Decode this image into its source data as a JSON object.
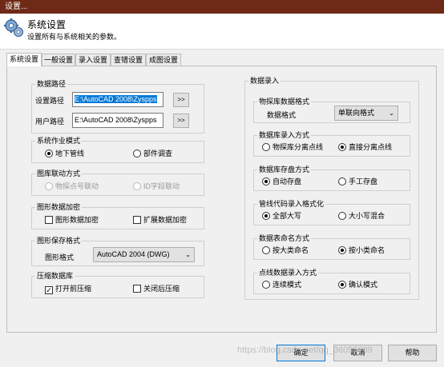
{
  "window_title": "设置...",
  "header": {
    "title": "系统设置",
    "subtitle": "设置所有与系统相关的参数。"
  },
  "tabs": [
    "系统设置",
    "一般设置",
    "录入设置",
    "查错设置",
    "成图设置"
  ],
  "data_path": {
    "title": "数据路径",
    "settings_label": "设置路径",
    "settings_value": "E:\\AutoCAD 2008\\Zyspps",
    "user_label": "用户路径",
    "user_value": "E:\\AutoCAD 2008\\Zyspps",
    "browse": ">>"
  },
  "work_mode": {
    "title": "系统作业模式",
    "options": [
      "地下管线",
      "部件调查"
    ],
    "selected": 0
  },
  "library_link": {
    "title": "图库联动方式",
    "options": [
      "物探点号联动",
      "ID字段联动"
    ]
  },
  "encryption": {
    "title": "图形数据加密",
    "options": [
      "图形数据加密",
      "扩展数据加密"
    ]
  },
  "save_format": {
    "title": "图形保存格式",
    "label": "图形格式",
    "value": "AutoCAD 2004 (DWG)"
  },
  "compress": {
    "title": "压缩数据库",
    "options": [
      "打开前压缩",
      "关闭后压缩"
    ],
    "checked": [
      true,
      false
    ]
  },
  "data_entry": {
    "title": "数据录入",
    "db_format": {
      "title": "物探库数据格式",
      "label": "数据格式",
      "value": "单联向格式"
    },
    "entry_mode": {
      "title": "数据库录入方式",
      "options": [
        "物探库分离点线",
        "直接分离点线"
      ],
      "selected": 1
    },
    "save_mode": {
      "title": "数据库存盘方式",
      "options": [
        "自动存盘",
        "手工存盘"
      ],
      "selected": 0
    },
    "code_format": {
      "title": "管线代码录入格式化",
      "options": [
        "全部大写",
        "大小写混合"
      ],
      "selected": 0
    },
    "table_naming": {
      "title": "数据表命名方式",
      "options": [
        "按大类命名",
        "按小类命名"
      ],
      "selected": 1
    },
    "point_entry": {
      "title": "点线数据录入方式",
      "options": [
        "连续模式",
        "确认模式"
      ],
      "selected": 1
    }
  },
  "buttons": {
    "ok": "确定",
    "cancel": "取消",
    "help": "帮助"
  },
  "watermark": "https://blog.csdn.net/qq_36053689"
}
